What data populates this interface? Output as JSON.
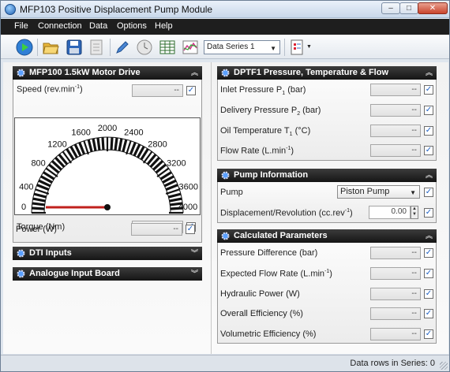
{
  "window": {
    "title": "MFP103 Positive Displacement Pump Module",
    "min": "–",
    "max": "□",
    "close": "✕"
  },
  "menu": [
    "File",
    "Connection",
    "Data",
    "Options",
    "Help"
  ],
  "toolbar": {
    "series_select": "Data Series 1",
    "icons": [
      "run-icon",
      "open-folder-icon",
      "save-icon",
      "export-icon",
      "pen-icon",
      "clock-icon",
      "table-icon",
      "graph-icon",
      "report-icon"
    ]
  },
  "motor": {
    "header": "MFP100 1.5kW Motor Drive",
    "speed_label": "Speed",
    "speed_unit": "(rev.min",
    "speed_unit_sup": "-1",
    "speed_unit_close": ")",
    "speed_value": "--",
    "gauge": {
      "min": 0,
      "max": 4000,
      "value": 0,
      "ticks": [
        "0",
        "400",
        "800",
        "1200",
        "1600",
        "2000",
        "2400",
        "2800",
        "3200",
        "3600",
        "4000"
      ]
    },
    "torque_label": "Torque  (Nm)",
    "torque_value": "--",
    "power_label": "Power  (W)",
    "power_value": "--"
  },
  "dti": {
    "header": "DTI Inputs"
  },
  "analogue": {
    "header": "Analogue Input Board"
  },
  "dptf": {
    "header": "DPTF1 Pressure, Temperature & Flow",
    "rows": [
      {
        "label": "Inlet Pressure P",
        "sub": "1",
        "unit": "  (bar)",
        "value": "--"
      },
      {
        "label": "Delivery Pressure P",
        "sub": "2",
        "unit": "  (bar)",
        "value": "--"
      },
      {
        "label": "Oil Temperature T",
        "sub": "1",
        "unit": "  (°C)",
        "value": "--"
      },
      {
        "label": "Flow Rate  (L.min",
        "sup": "-1",
        "unit": ")",
        "value": "--"
      }
    ]
  },
  "pump": {
    "header": "Pump Information",
    "pump_label": "Pump",
    "pump_value": "Piston Pump",
    "disp_label": "Displacement/Revolution  (cc.rev",
    "disp_sup": "-1",
    "disp_close": ")",
    "disp_value": "0.00"
  },
  "calc": {
    "header": "Calculated Parameters",
    "rows": [
      {
        "label": "Pressure Difference  (bar)",
        "value": "--"
      },
      {
        "label": "Expected Flow Rate  (L.min",
        "sup": "-1",
        "unit": ")",
        "value": "--"
      },
      {
        "label": "Hydraulic Power  (W)",
        "value": "--"
      },
      {
        "label": "Overall Efficiency  (%)",
        "value": "--"
      },
      {
        "label": "Volumetric Efficiency  (%)",
        "value": "--"
      }
    ]
  },
  "status": {
    "text": "Data rows in Series: 0"
  }
}
